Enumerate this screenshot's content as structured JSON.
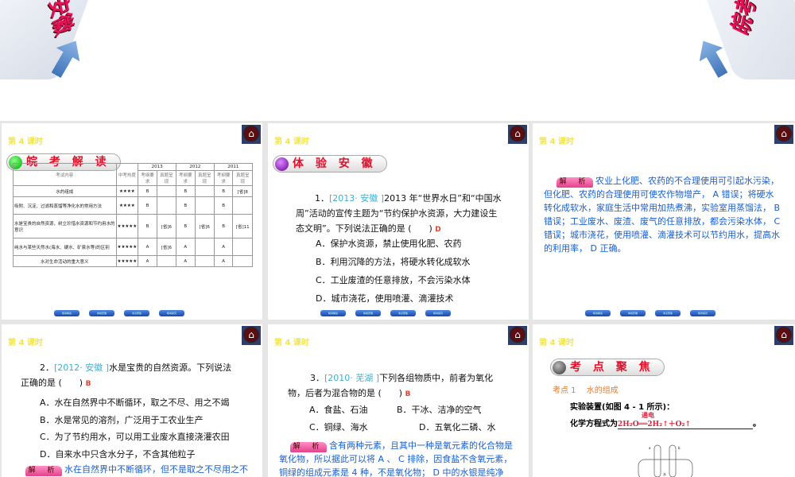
{
  "banner": {
    "left_text": "安徽",
    "right_text": "皖考"
  },
  "lesson": "第 4 课时",
  "nav": [
    "皖考解读",
    "体验安徽",
    "考点聚焦",
    "皖考探究"
  ],
  "slide1": {
    "title": "皖 考 解 读",
    "headers": {
      "content": "考试内容",
      "heat": "中考热度",
      "years": [
        "2013",
        "2012",
        "2011"
      ],
      "req": "考纲要求",
      "real": "真题呈现"
    },
    "rows": [
      {
        "content": "水的组成",
        "heat": "★★★★",
        "c": [
          "B",
          "",
          "B",
          "",
          "B",
          "[省]8"
        ]
      },
      {
        "content": "吸附、沉淀、过滤和蒸馏等净化水的常用方法",
        "heat": "★★★★",
        "c": [
          "B",
          "",
          "B",
          "",
          "B",
          ""
        ]
      },
      {
        "content": "水是宝贵的自然资源，树立珍惜水资源和节约用水的意识",
        "heat": "★★★★★",
        "c": [
          "B",
          "[省]6",
          "B",
          "[省]6",
          "B",
          "[省]11"
        ]
      },
      {
        "content": "纯水与某些天然水(海水、硬水、矿泉水等)的区别",
        "heat": "★★★★★",
        "c": [
          "A",
          "[省]6",
          "A",
          "",
          "A",
          ""
        ]
      },
      {
        "content": "水对生命活动的重大意义",
        "heat": "★★★★★",
        "c": [
          "A",
          "",
          "A",
          "",
          "A",
          ""
        ]
      }
    ]
  },
  "slide2": {
    "title": "体 验 安 徽",
    "num": "1．",
    "src": "[2013· 安徽 ]",
    "stem": "2013 年“世界水日”和“中国水周”活动的宣传主题为“节约保护水资源，大力建设生态文明”。下列说法正确的是 (　　)",
    "answer": "D",
    "options": [
      "A．保护水资源，禁止使用化肥、农药",
      "B．利用沉降的方法，将硬水转化成软水",
      "C．工业废渣的任意排放，不会污染水体",
      "D．城市浇花，使用喷灌、滴灌技术"
    ]
  },
  "slide3": {
    "label": "解 析",
    "text": "农业上化肥、农药的不合理使用可引起水污染，但化肥、农药的合理使用可使农作物增产， A 错误；将硬水转化成软水，家庭生活中常用加热煮沸，实验室用蒸馏法， B 错误；工业废水、废渣、废气的任意排放，都会污染水体， C 错误；城市浇花，使用喷灌、滴灌技术可以节约用水，提高水的利用率， D 正确。"
  },
  "slide4": {
    "num": "2．",
    "src": "[2012· 安徽 ]",
    "stem": "水是宝贵的自然资源。下列说法正确的是 (　　)",
    "answer": "B",
    "options": [
      "A．水在自然界中不断循环，取之不尽、用之不竭",
      "B．水是常见的溶剂，广泛用于工农业生产",
      "C．为了节约用水，可以用工业废水直接浇灌农田",
      "D．自来水中只含水分子，不含其他粒子"
    ],
    "label": "解 析",
    "exp": "水在自然界中不断循环，但不是取之不尽用之不"
  },
  "slide5": {
    "num": "3．",
    "src": "[2010· 芜湖 ]",
    "stem": "下列各组物质中，前者为氧化物，后者为混合物的是 (　　)",
    "answer": "B",
    "options": [
      "A．食盐、石油",
      "B．干冰、洁净的空气",
      "C．铜绿、海水",
      "D．五氧化二磷、水"
    ],
    "label": "解 析",
    "exp": "含有两种元素，且其中一种是氧元素的化合物是氧化物，所以据此可以将 A 、 C 排除，因食盐不含氧元素，铜绿的组成元素是 4 种，不是氧化物； D 中的水银是纯净物，"
  },
  "slide6": {
    "title": "考 点 聚 焦",
    "point": "考点 1　 水的组成",
    "line1": "实验装置(如图 4 - 1 所示)：",
    "line2": "化学方程式为",
    "equation": "2H₂O══2H₂↑＋O₂↑",
    "condition": "通电",
    "label_a": "a",
    "label_b": "b",
    "water": "水"
  }
}
